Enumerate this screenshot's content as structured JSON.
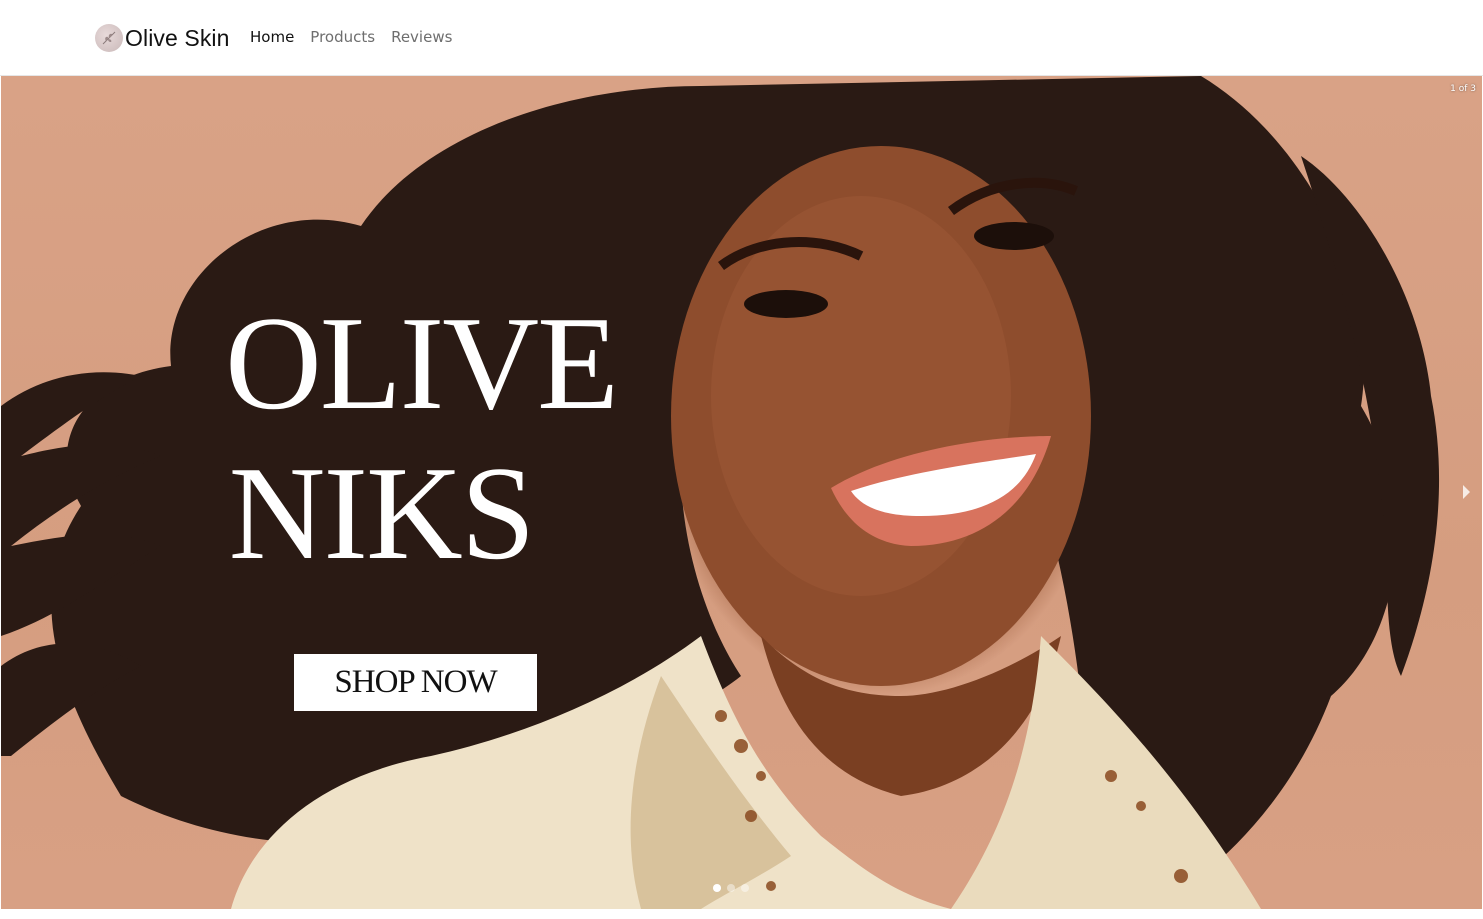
{
  "navbar": {
    "brand_name": "Olive Skin",
    "logo_icon": "leaf-emblem-icon",
    "links": [
      {
        "label": "Home",
        "active": true
      },
      {
        "label": "Products",
        "active": false
      },
      {
        "label": "Reviews",
        "active": false
      }
    ]
  },
  "hero": {
    "slide_counter": "1 of 3",
    "headline_line1": "OLIVE",
    "headline_line2": "NIKS",
    "cta_label": "SHOP NOW",
    "next_icon": "chevron-right-icon",
    "slides_total": 3,
    "active_slide": 1
  },
  "colors": {
    "background": "#D8A084",
    "nav_active": "#111111",
    "nav_inactive": "#6E6E6E",
    "headline": "#FFFFFF"
  }
}
